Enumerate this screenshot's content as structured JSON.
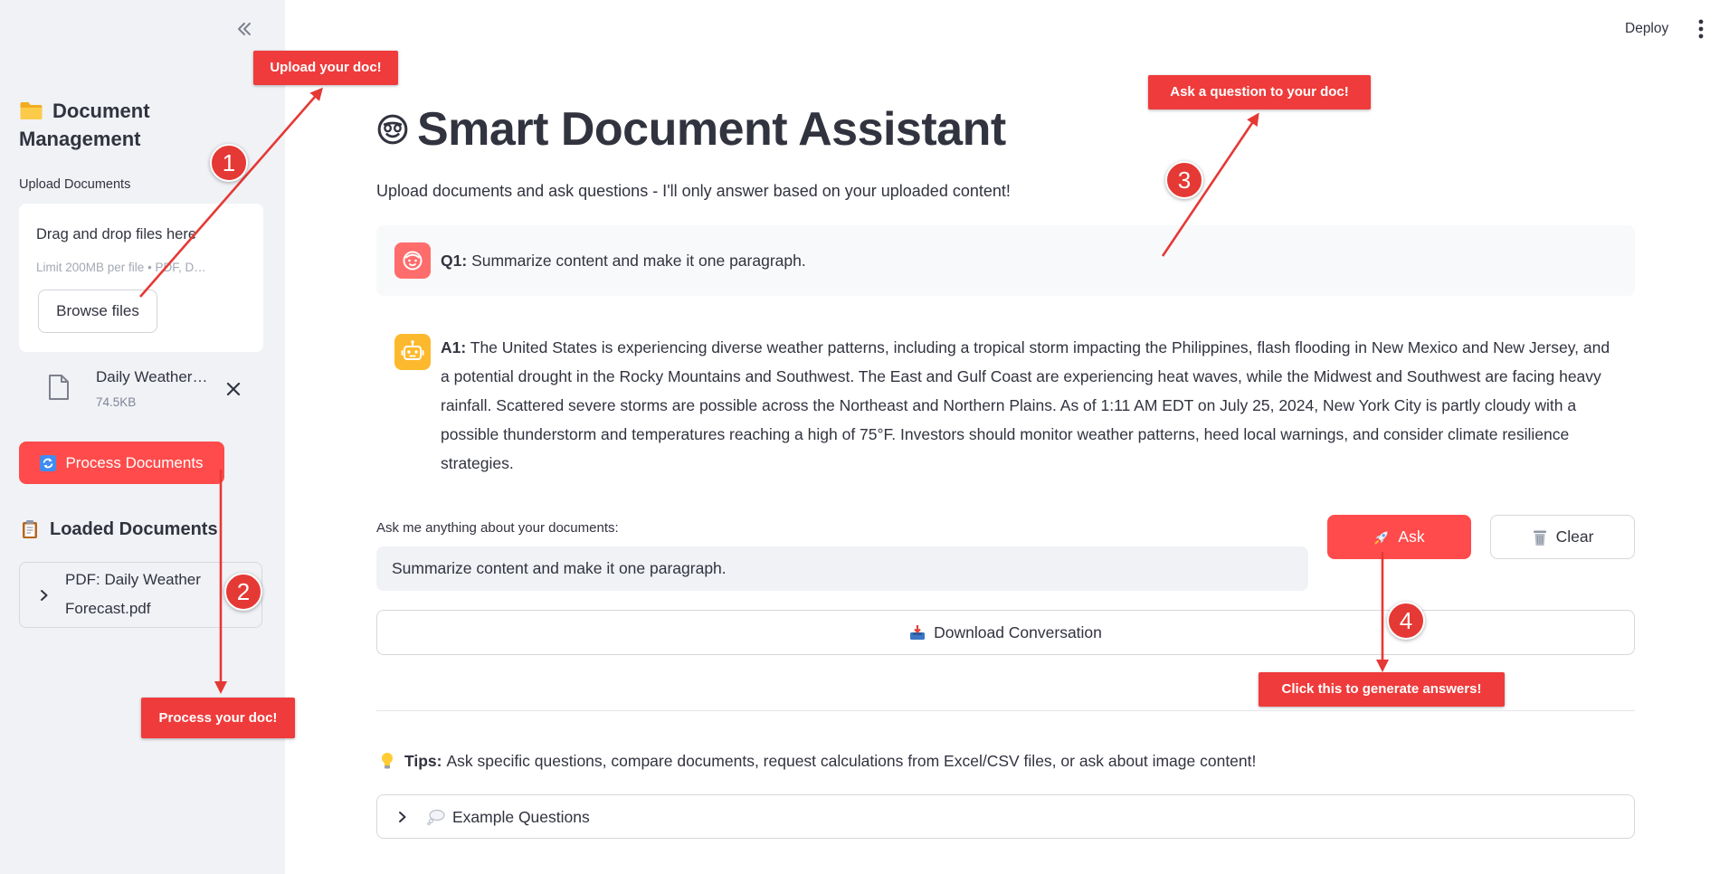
{
  "header": {
    "deploy_label": "Deploy",
    "menu_icon": "more-vertical-icon"
  },
  "sidebar": {
    "collapse_icon": "double-chevron-left-icon",
    "title_icon": "folder-icon",
    "title": "Document Management",
    "upload": {
      "label": "Upload Documents",
      "dropzone_text": "Drag and drop files here",
      "limit_text": "Limit 200MB per file • PDF, D…",
      "browse_label": "Browse files"
    },
    "file": {
      "icon": "file-icon",
      "name": "Daily Weather…",
      "size": "74.5KB",
      "remove_icon": "close-icon"
    },
    "process_button": {
      "icon": "refresh-icon",
      "label": "Process Documents"
    },
    "loaded": {
      "icon": "clipboard-icon",
      "title": "Loaded Documents",
      "items": [
        {
          "label": "PDF: Daily Weather Forecast.pdf"
        }
      ]
    }
  },
  "main": {
    "title_icon": "smiling-face-icon",
    "title": "Smart Document Assistant",
    "subtitle": "Upload documents and ask questions - I'll only answer based on your uploaded content!",
    "conversation": [
      {
        "role": "user",
        "avatar_icon": "user-face-icon",
        "prefix": "Q1:",
        "text": "Summarize content and make it one paragraph."
      },
      {
        "role": "assistant",
        "avatar_icon": "robot-icon",
        "prefix": "A1:",
        "text": "The United States is experiencing diverse weather patterns, including a tropical storm impacting the Philippines, flash flooding in New Mexico and New Jersey, and a potential drought in the Rocky Mountains and Southwest. The East and Gulf Coast are experiencing heat waves, while the Midwest and Southwest are facing heavy rainfall. Scattered severe storms are possible across the Northeast and Northern Plains. As of 1:11 AM EDT on July 25, 2024, New York City is partly cloudy with a possible thunderstorm and temperatures reaching a high of 75°F. Investors should monitor weather patterns, heed local warnings, and consider climate resilience strategies."
      }
    ],
    "question_input": {
      "label": "Ask me anything about your documents:",
      "value": "Summarize content and make it one paragraph."
    },
    "ask_button": {
      "icon": "rocket-icon",
      "label": "Ask"
    },
    "clear_button": {
      "icon": "trash-icon",
      "label": "Clear"
    },
    "download_button": {
      "icon": "inbox-tray-icon",
      "label": "Download Conversation"
    },
    "tips": {
      "icon": "lightbulb-icon",
      "label": "Tips:",
      "text": "Ask specific questions, compare documents, request calculations from Excel/CSV files, or ask about image content!"
    },
    "examples_expander": {
      "icon": "thought-balloon-icon",
      "label": "Example Questions"
    }
  },
  "annotations": [
    {
      "step": "1",
      "label": "Upload your doc!"
    },
    {
      "step": "2",
      "label": "Process your doc!"
    },
    {
      "step": "3",
      "label": "Ask a question to your doc!"
    },
    {
      "step": "4",
      "label": "Click this to generate answers!"
    }
  ],
  "colors": {
    "primary": "#ff4b4b",
    "annotation": "#e53935",
    "sidebar_bg": "#f0f2f6",
    "text": "#31333f",
    "user_avatar": "#ff6c6c",
    "assistant_avatar": "#fdb92e"
  }
}
